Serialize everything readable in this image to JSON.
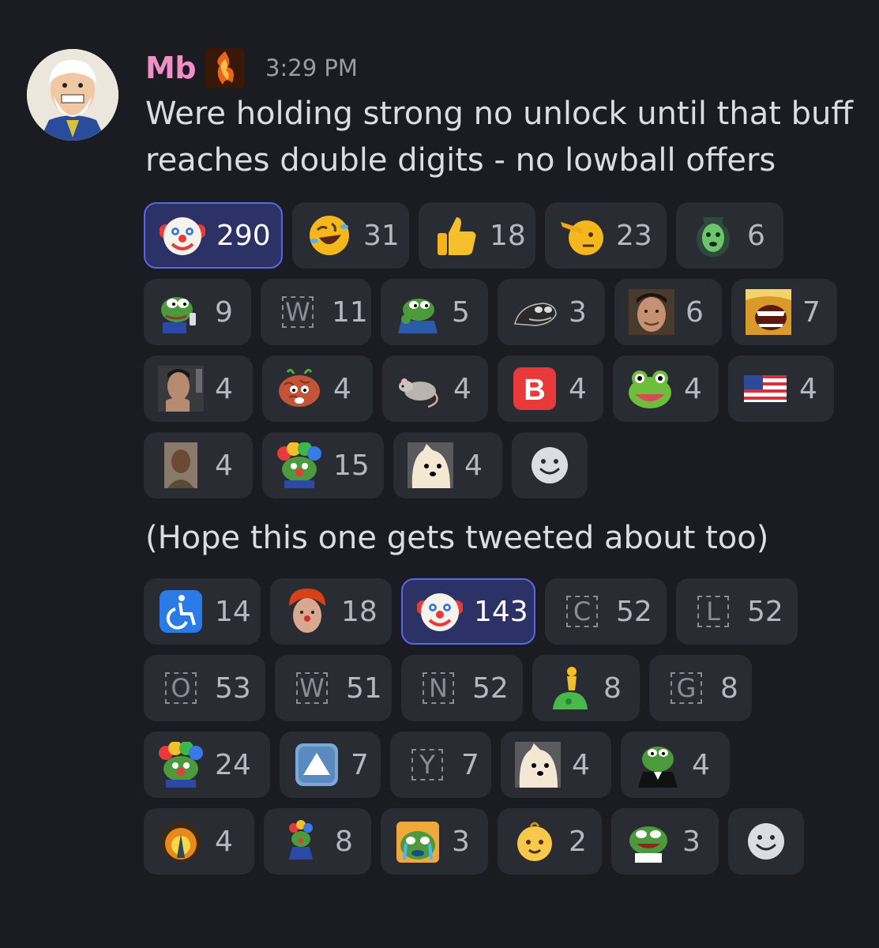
{
  "message": {
    "username": "Mb",
    "timestamp": "3:29 PM",
    "text": "Were holding strong no unlock until that buff reaches double digits - no lowball offers",
    "followup": "(Hope this one gets tweeted about too)"
  },
  "reactions1": {
    "row1": [
      {
        "icon": "clown-face-emoji",
        "count": "290",
        "active": true
      },
      {
        "icon": "rolling-on-floor-laughing-emoji",
        "count": "31"
      },
      {
        "icon": "thumbs-up-emoji",
        "count": "18"
      },
      {
        "icon": "saluting-face-emoji",
        "count": "23"
      },
      {
        "icon": "green-face-jar-emoji",
        "count": "6"
      }
    ],
    "row2": [
      {
        "icon": "pepe-phone-emoji",
        "count": "9"
      },
      {
        "icon": "letter-w-emoji",
        "letter": "W",
        "count": "11"
      },
      {
        "icon": "pepe-hands-emoji",
        "count": "5"
      },
      {
        "icon": "dark-pepe-emoji",
        "count": "3"
      },
      {
        "icon": "man-face-emoji",
        "count": "6"
      },
      {
        "icon": "screaming-face-emoji",
        "count": "7"
      }
    ],
    "row3": [
      {
        "icon": "thinking-man-emoji",
        "count": "4"
      },
      {
        "icon": "brain-face-emoji",
        "count": "4"
      },
      {
        "icon": "rat-emoji",
        "count": "4"
      },
      {
        "icon": "b-button-emoji",
        "count": "4"
      },
      {
        "icon": "frog-face-emoji",
        "count": "4"
      },
      {
        "icon": "us-flag-emoji",
        "count": "4"
      }
    ],
    "row4": [
      {
        "icon": "kanye-face-emoji",
        "count": "4"
      },
      {
        "icon": "clown-pepe-emoji",
        "count": "15"
      },
      {
        "icon": "dog-face-emoji",
        "count": "4"
      }
    ]
  },
  "reactions2": {
    "row1": [
      {
        "icon": "wheelchair-symbol-emoji",
        "count": "14"
      },
      {
        "icon": "clown-wig-man-emoji",
        "count": "18"
      },
      {
        "icon": "clown-face-emoji",
        "count": "143",
        "active": true
      },
      {
        "icon": "letter-c-emoji",
        "letter": "C",
        "count": "52"
      },
      {
        "icon": "letter-l-emoji",
        "letter": "L",
        "count": "52"
      }
    ],
    "row2": [
      {
        "icon": "letter-o-emoji",
        "letter": "O",
        "count": "53"
      },
      {
        "icon": "letter-w-emoji",
        "letter": "W",
        "count": "51"
      },
      {
        "icon": "letter-n-emoji",
        "letter": "N",
        "count": "52"
      },
      {
        "icon": "person-riding-emoji",
        "count": "8"
      },
      {
        "icon": "letter-g-emoji",
        "letter": "G",
        "count": "8"
      }
    ],
    "row3": [
      {
        "icon": "clown-pepe-emoji",
        "count": "24"
      },
      {
        "icon": "up-button-emoji",
        "count": "7"
      },
      {
        "icon": "letter-y-emoji",
        "letter": "Y",
        "count": "7"
      },
      {
        "icon": "dog-face-emoji",
        "count": "4"
      },
      {
        "icon": "pepe-suit-emoji",
        "count": "4"
      }
    ],
    "row4": [
      {
        "icon": "fire-aura-emoji",
        "count": "4"
      },
      {
        "icon": "small-clown-pepe-emoji",
        "count": "8"
      },
      {
        "icon": "crying-pepe-emoji",
        "count": "3"
      },
      {
        "icon": "baby-emoji",
        "count": "2"
      },
      {
        "icon": "pepe-laugh-emoji",
        "count": "3"
      }
    ]
  }
}
